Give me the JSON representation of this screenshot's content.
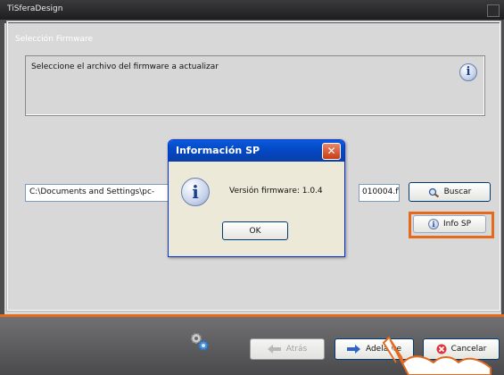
{
  "window": {
    "title": "TiSferaDesign"
  },
  "section": {
    "legend": "Selección Firmware",
    "instruction": "Seleccione el archivo del firmware a actualizar"
  },
  "file": {
    "path_left": "C:\\Documents and Settings\\pc-",
    "path_right": "010004.f\\"
  },
  "buttons": {
    "buscar": "Buscar",
    "info_sp": "Info SP",
    "atras": "Atrás",
    "adelante": "Adelante",
    "cancelar": "Cancelar"
  },
  "dialog": {
    "title": "Información SP",
    "close": "✕",
    "message": "Versión firmware: 1.0.4",
    "ok": "OK"
  },
  "icons": [
    "info-icon",
    "search-icon",
    "back-arrow-icon",
    "forward-arrow-icon",
    "cancel-icon",
    "gear-icon",
    "hand-cursor-icon"
  ],
  "colors": {
    "highlight": "#e56a1c",
    "dialog_title": "#0348c4"
  }
}
